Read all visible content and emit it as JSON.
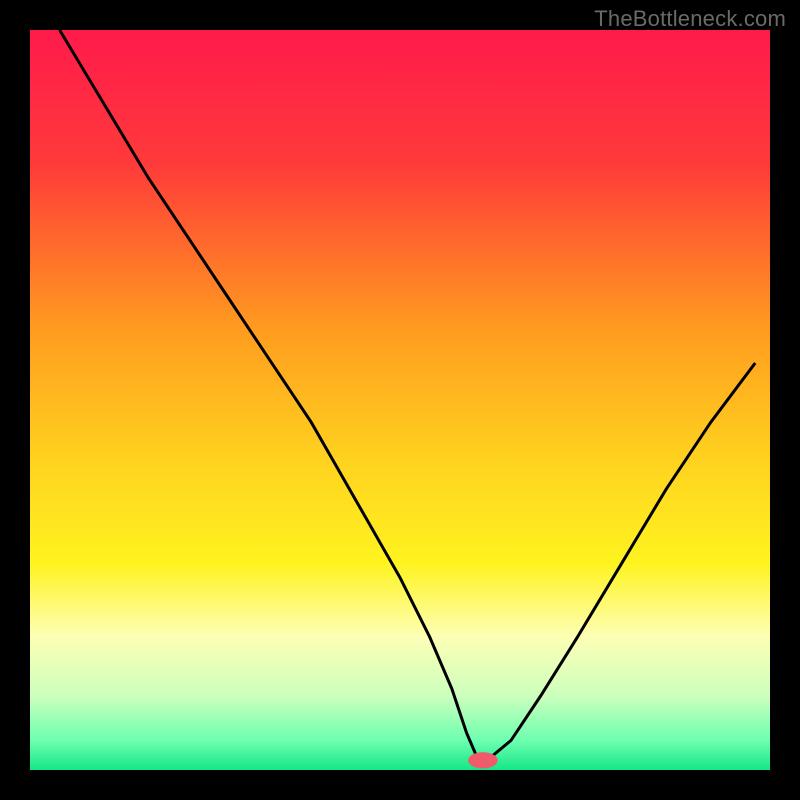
{
  "watermark": "TheBottleneck.com",
  "chart_data": {
    "type": "line",
    "title": "",
    "xlabel": "",
    "ylabel": "",
    "xlim": [
      0,
      100
    ],
    "ylim": [
      0,
      100
    ],
    "grid": false,
    "legend": false,
    "background_gradient_stops": [
      {
        "offset": 0.0,
        "color": "#ff1a4b"
      },
      {
        "offset": 0.18,
        "color": "#ff3a3a"
      },
      {
        "offset": 0.4,
        "color": "#ff9a1f"
      },
      {
        "offset": 0.58,
        "color": "#ffd21f"
      },
      {
        "offset": 0.72,
        "color": "#fff31f"
      },
      {
        "offset": 0.82,
        "color": "#fdffb5"
      },
      {
        "offset": 0.9,
        "color": "#ccffbd"
      },
      {
        "offset": 0.96,
        "color": "#6dffb0"
      },
      {
        "offset": 1.0,
        "color": "#14e786"
      }
    ],
    "series": [
      {
        "name": "bottleneck-curve",
        "color": "#000000",
        "x": [
          4,
          10,
          16,
          22,
          26,
          30,
          34,
          38,
          42,
          46,
          50,
          54,
          57,
          59,
          60.5,
          62,
          65,
          69,
          74,
          80,
          86,
          92,
          98
        ],
        "y": [
          100,
          90,
          80,
          71,
          65,
          59,
          53,
          47,
          40,
          33,
          26,
          18,
          11,
          5,
          1.5,
          1.5,
          4,
          10,
          18,
          28,
          38,
          47,
          55
        ]
      }
    ],
    "marker": {
      "name": "optimal-point",
      "x": 61.2,
      "y": 1.3,
      "rx": 2.0,
      "ry": 1.1,
      "color": "#ef5b6a"
    }
  }
}
